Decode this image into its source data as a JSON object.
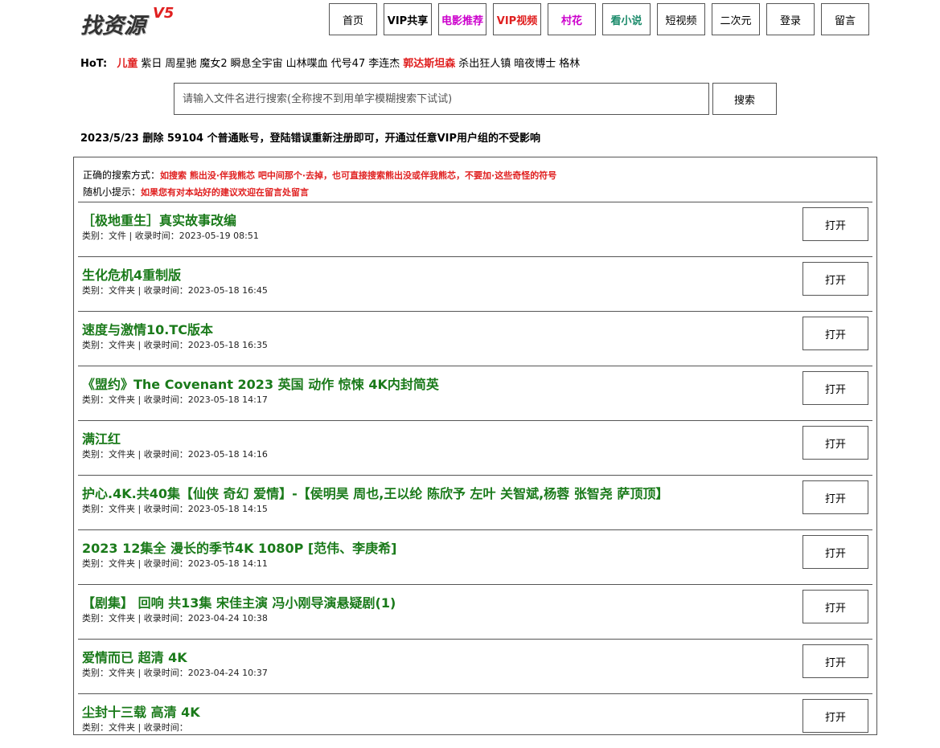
{
  "logo": {
    "text": "找资源",
    "version": "V5"
  },
  "nav": [
    {
      "label": "首页",
      "color": "#000000",
      "bold": false
    },
    {
      "label": "VIP共享",
      "color": "#000000",
      "bold": true
    },
    {
      "label": "电影推荐",
      "color": "#cc00cc",
      "bold": true
    },
    {
      "label": "VIP视频",
      "color": "#e02020",
      "bold": true
    },
    {
      "label": "村花",
      "color": "#cc00cc",
      "bold": true
    },
    {
      "label": "看小说",
      "color": "#1a8a6a",
      "bold": true
    },
    {
      "label": "短视频",
      "color": "#000000",
      "bold": false
    },
    {
      "label": "二次元",
      "color": "#000000",
      "bold": false
    },
    {
      "label": "登录",
      "color": "#000000",
      "bold": false
    },
    {
      "label": "留言",
      "color": "#000000",
      "bold": false
    }
  ],
  "hot": {
    "label": "HoT:",
    "items": [
      {
        "text": "儿童",
        "highlight": true
      },
      {
        "text": "紫日",
        "highlight": false
      },
      {
        "text": "周星驰",
        "highlight": false
      },
      {
        "text": "魔女2",
        "highlight": false
      },
      {
        "text": "瞬息全宇宙",
        "highlight": false
      },
      {
        "text": "山林喋血",
        "highlight": false
      },
      {
        "text": "代号47",
        "highlight": false
      },
      {
        "text": "李连杰",
        "highlight": false
      },
      {
        "text": "郭达斯坦森",
        "highlight": true
      },
      {
        "text": "杀出狂人镇",
        "highlight": false
      },
      {
        "text": "暗夜博士",
        "highlight": false
      },
      {
        "text": "格林",
        "highlight": false
      }
    ]
  },
  "search": {
    "placeholder": "请输入文件名进行搜索(全称搜不到用单字模糊搜索下试试)",
    "button": "搜索"
  },
  "notice": "2023/5/23 删除 59104 个普通账号，登陆错误重新注册即可，开通过任意VIP用户组的不受影响",
  "tips": {
    "search_label": "正确的搜索方式：",
    "search_text": "如搜索 熊出没·伴我熊芯 吧中间那个·去掉，也可直接搜索熊出没或伴我熊芯，不要加·这些奇怪的符号",
    "random_label": "随机小提示：",
    "random_text": "如果您有对本站好的建议欢迎在留言处留言"
  },
  "results": [
    {
      "title": "［极地重生］真实故事改编",
      "meta": "类别：文件 | 收录时间：2023-05-19 08:51",
      "button": "打开"
    },
    {
      "title": "生化危机4重制版",
      "meta": "类别：文件夹 | 收录时间：2023-05-18 16:45",
      "button": "打开"
    },
    {
      "title": "速度与激情10.TC版本",
      "meta": "类别：文件夹 | 收录时间：2023-05-18 16:35",
      "button": "打开"
    },
    {
      "title": "《盟约》The Covenant 2023 英国 动作 惊悚 4K内封简英",
      "meta": "类别：文件夹 | 收录时间：2023-05-18 14:17",
      "button": "打开"
    },
    {
      "title": "满江红",
      "meta": "类别：文件夹 | 收录时间：2023-05-18 14:16",
      "button": "打开"
    },
    {
      "title": "护心.4K.共40集【仙侠 奇幻 爱情】-【侯明昊 周也,王以纶 陈欣予 左叶 关智斌,杨蓉 张智尧 萨顶顶】",
      "meta": "类别：文件夹 | 收录时间：2023-05-18 14:15",
      "button": "打开"
    },
    {
      "title": "2023 12集全 漫长的季节4K 1080P [范伟、李庚希]",
      "meta": "类别：文件夹 | 收录时间：2023-05-18 14:11",
      "button": "打开"
    },
    {
      "title": "【剧集】 回响 共13集 宋佳主演 冯小刚导演悬疑剧(1)",
      "meta": "类别：文件夹 | 收录时间：2023-04-24 10:38",
      "button": "打开"
    },
    {
      "title": "爱情而已 超清 4K",
      "meta": "类别：文件夹 | 收录时间：2023-04-24 10:37",
      "button": "打开"
    },
    {
      "title": "尘封十三载 高清 4K",
      "meta": "类别：文件夹 | 收录时间：",
      "button": "打开"
    }
  ]
}
